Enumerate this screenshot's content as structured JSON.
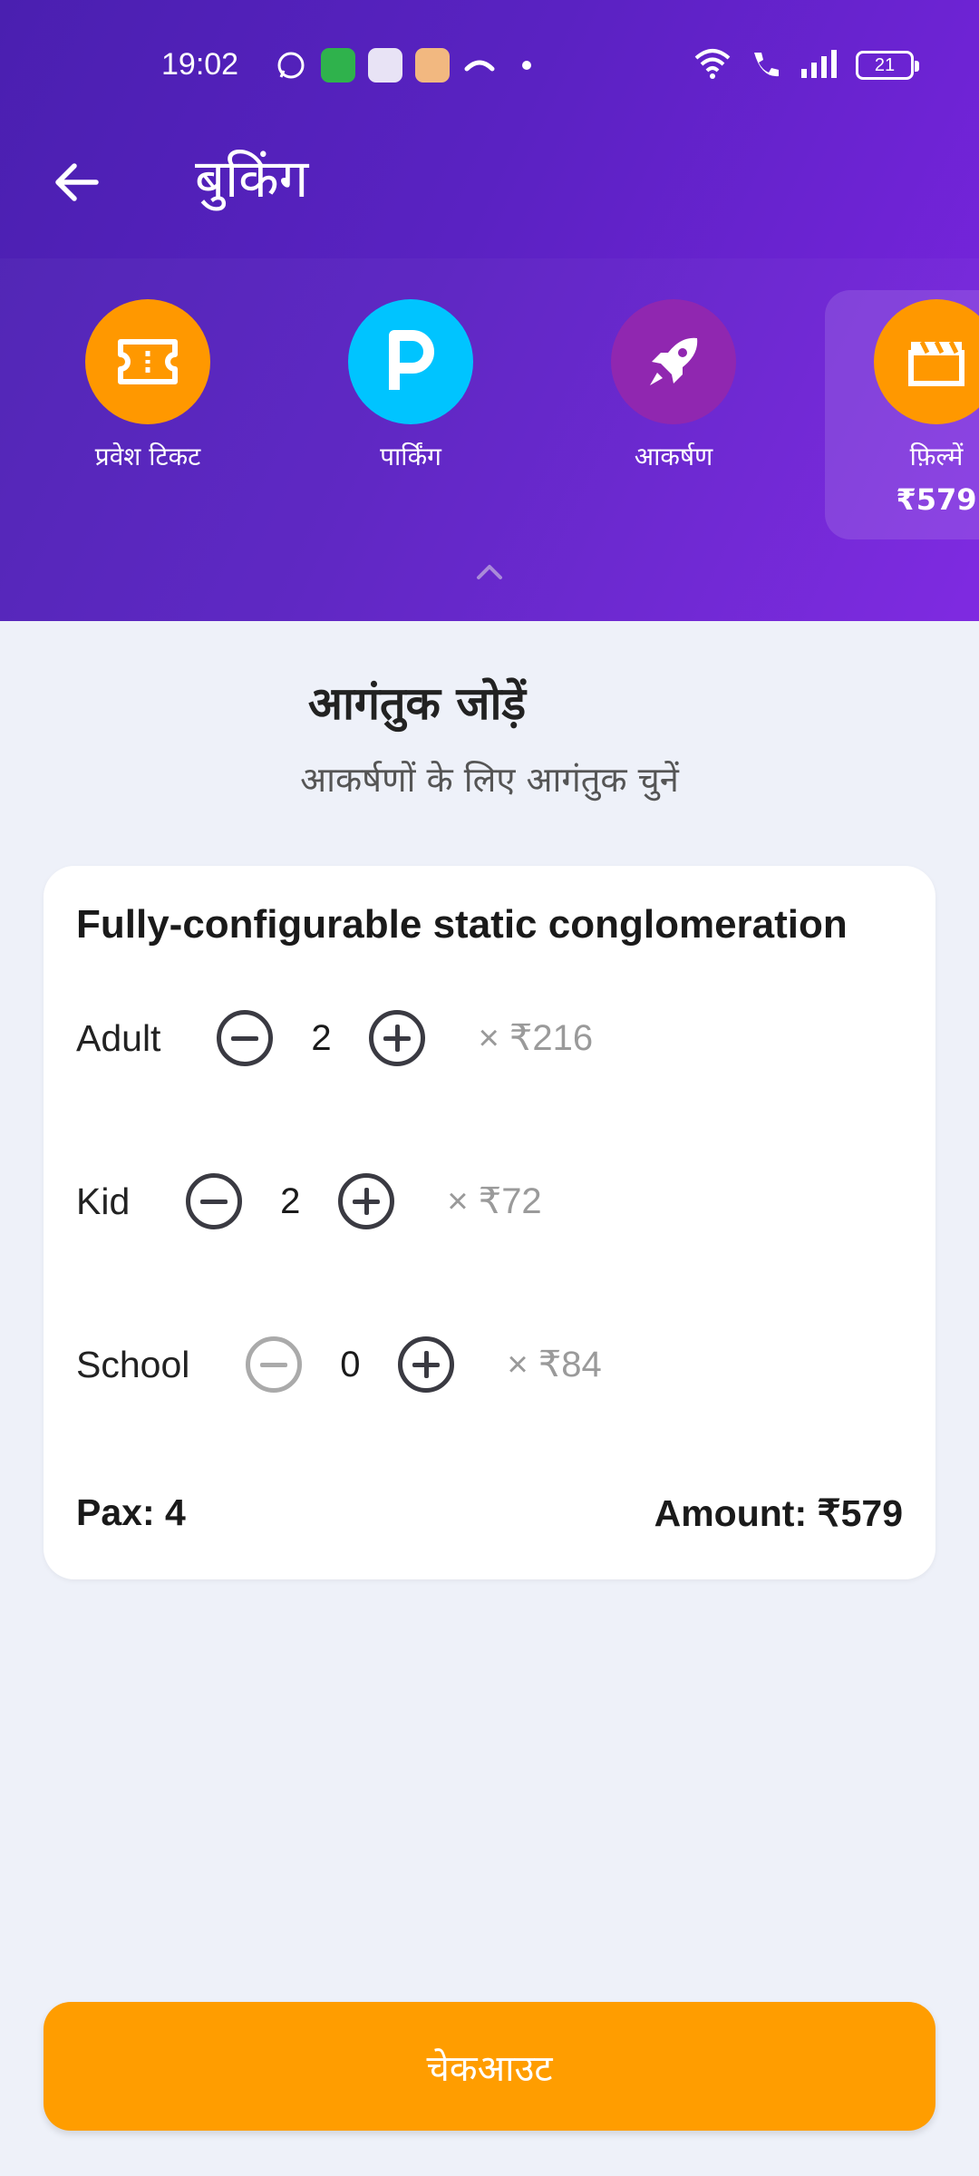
{
  "status_bar": {
    "time": "19:02",
    "battery": "21"
  },
  "app_bar": {
    "title": "बुकिंग"
  },
  "categories": [
    {
      "label": "प्रवेश टिकट",
      "icon": "ticket-icon",
      "color": "#ff9800"
    },
    {
      "label": "पार्किंग",
      "icon": "parking-icon",
      "color": "#00c4ff"
    },
    {
      "label": "आकर्षण",
      "icon": "rocket-icon",
      "color": "#9027b0"
    },
    {
      "label": "फ़िल्में",
      "icon": "movie-clapper-icon",
      "color": "#ff9800",
      "price": "₹579",
      "selected": true
    }
  ],
  "section": {
    "title": "आगंतुक जोड़ें",
    "subtitle": "आकर्षणों के लिए आगंतुक चुनें"
  },
  "card": {
    "title": "Fully-configurable static conglomeration",
    "rows": [
      {
        "label": "Adult",
        "qty": "2",
        "price": "× ₹216",
        "minus_enabled": true
      },
      {
        "label": "Kid",
        "qty": "2",
        "price": "× ₹72",
        "minus_enabled": true
      },
      {
        "label": "School",
        "qty": "0",
        "price": "× ₹84",
        "minus_enabled": false
      }
    ],
    "pax": "Pax: 4",
    "amount": "Amount: ₹579"
  },
  "checkout": {
    "label": "चेकआउट"
  },
  "colors": {
    "header_start": "#4a1fb0",
    "header_end": "#7b24e0",
    "accent": "#ff9d00",
    "background": "#eef1f9"
  }
}
